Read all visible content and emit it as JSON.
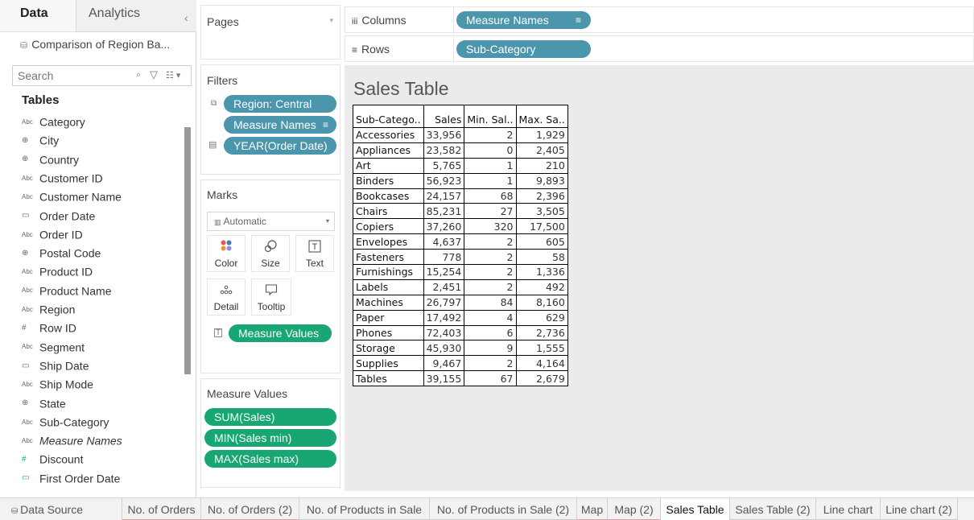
{
  "left_pane": {
    "tabs": [
      "Data",
      "Analytics"
    ],
    "collapse_glyph": "‹",
    "datasource": "Comparison of Region Ba...",
    "search_placeholder": "Search",
    "tables_heading": "Tables",
    "fields": [
      {
        "type": "Abc",
        "name": "Category"
      },
      {
        "type": "geo",
        "name": "City"
      },
      {
        "type": "geo",
        "name": "Country"
      },
      {
        "type": "Abc",
        "name": "Customer ID"
      },
      {
        "type": "Abc",
        "name": "Customer Name"
      },
      {
        "type": "date",
        "name": "Order Date"
      },
      {
        "type": "Abc",
        "name": "Order ID"
      },
      {
        "type": "geo",
        "name": "Postal Code"
      },
      {
        "type": "Abc",
        "name": "Product ID"
      },
      {
        "type": "Abc",
        "name": "Product Name"
      },
      {
        "type": "Abc",
        "name": "Region"
      },
      {
        "type": "#",
        "name": "Row ID"
      },
      {
        "type": "Abc",
        "name": "Segment"
      },
      {
        "type": "date",
        "name": "Ship Date"
      },
      {
        "type": "Abc",
        "name": "Ship Mode"
      },
      {
        "type": "geo",
        "name": "State"
      },
      {
        "type": "Abc",
        "name": "Sub-Category"
      },
      {
        "type": "Abc",
        "name": "Measure Names"
      },
      {
        "type": "#",
        "name": "Discount"
      },
      {
        "type": "date",
        "name": "First Order Date"
      }
    ]
  },
  "pages": {
    "title": "Pages"
  },
  "filters": {
    "title": "Filters",
    "pills": [
      "Region: Central",
      "Measure Names",
      "YEAR(Order Date)"
    ]
  },
  "marks": {
    "title": "Marks",
    "type": "Automatic",
    "buttons": [
      "Color",
      "Size",
      "Text",
      "Detail",
      "Tooltip"
    ],
    "text_pill": "Measure Values"
  },
  "measure_values": {
    "title": "Measure Values",
    "pills": [
      "SUM(Sales)",
      "MIN(Sales min)",
      "MAX(Sales max)"
    ]
  },
  "columns": {
    "label": "Columns",
    "pill": "Measure Names"
  },
  "rows": {
    "label": "Rows",
    "pill": "Sub-Category"
  },
  "view": {
    "title": "Sales Table",
    "headers": [
      "Sub-Catego..",
      "Sales",
      "Min. Sal..",
      "Max. Sa.."
    ],
    "rows": [
      [
        "Accessories",
        "33,956",
        "2",
        "1,929"
      ],
      [
        "Appliances",
        "23,582",
        "0",
        "2,405"
      ],
      [
        "Art",
        "5,765",
        "1",
        "210"
      ],
      [
        "Binders",
        "56,923",
        "1",
        "9,893"
      ],
      [
        "Bookcases",
        "24,157",
        "68",
        "2,396"
      ],
      [
        "Chairs",
        "85,231",
        "27",
        "3,505"
      ],
      [
        "Copiers",
        "37,260",
        "320",
        "17,500"
      ],
      [
        "Envelopes",
        "4,637",
        "2",
        "605"
      ],
      [
        "Fasteners",
        "778",
        "2",
        "58"
      ],
      [
        "Furnishings",
        "15,254",
        "2",
        "1,336"
      ],
      [
        "Labels",
        "2,451",
        "2",
        "492"
      ],
      [
        "Machines",
        "26,797",
        "84",
        "8,160"
      ],
      [
        "Paper",
        "17,492",
        "4",
        "629"
      ],
      [
        "Phones",
        "72,403",
        "6",
        "2,736"
      ],
      [
        "Storage",
        "45,930",
        "9",
        "1,555"
      ],
      [
        "Supplies",
        "9,467",
        "2",
        "4,164"
      ],
      [
        "Tables",
        "39,155",
        "67",
        "2,679"
      ]
    ]
  },
  "tabs": {
    "data_source": "Data Source",
    "sheets": [
      "No. of Orders",
      "No. of Orders (2)",
      "No. of Products in Sale",
      "No. of Products in Sale (2)",
      "Map",
      "Map (2)",
      "Sales Table",
      "Sales Table (2)",
      "Line chart",
      "Line chart (2)"
    ],
    "active": "Sales Table"
  },
  "colors": {
    "dimension_pill": "#4b96ad",
    "measure_pill": "#18a672"
  }
}
